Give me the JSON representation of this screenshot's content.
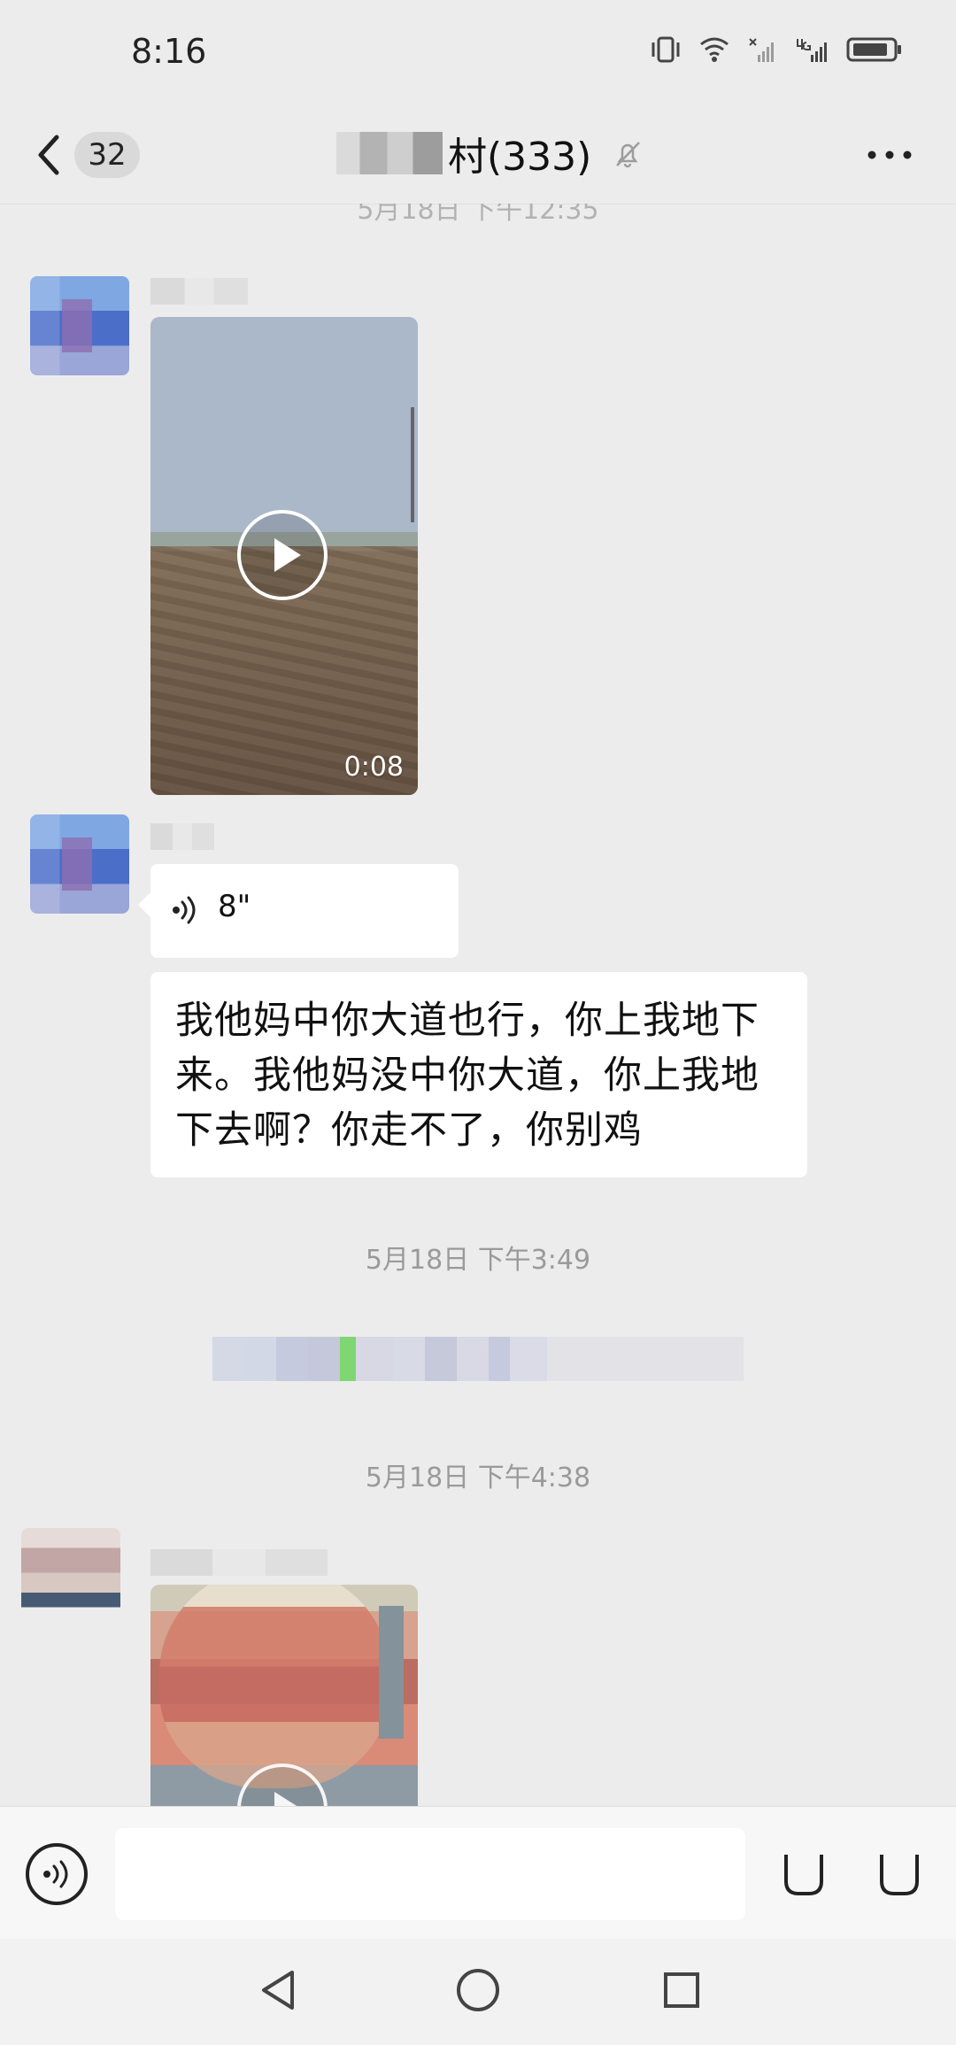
{
  "status_bar": {
    "time": "8:16"
  },
  "header": {
    "unread_count": "32",
    "title": "村(333)"
  },
  "messages": {
    "top_timestamp": "5月18日 下午12:35",
    "video_duration_1": "0:08",
    "voice_duration": "8\"",
    "text_message": "我他妈中你大道也行，你上我地下来。我他妈没中你大道，你上我地下去啊？你走不了，你别鸡",
    "timestamp_1": "5月18日 下午3:49",
    "timestamp_2": "5月18日 下午4:38"
  },
  "input": {
    "placeholder": ""
  },
  "icons": {
    "back": "chevron-left-icon",
    "mute": "bell-off-icon",
    "more": "more-icon",
    "play": "play-icon",
    "voice": "voice-icon",
    "emoji": "emoji-icon",
    "add": "add-icon"
  }
}
